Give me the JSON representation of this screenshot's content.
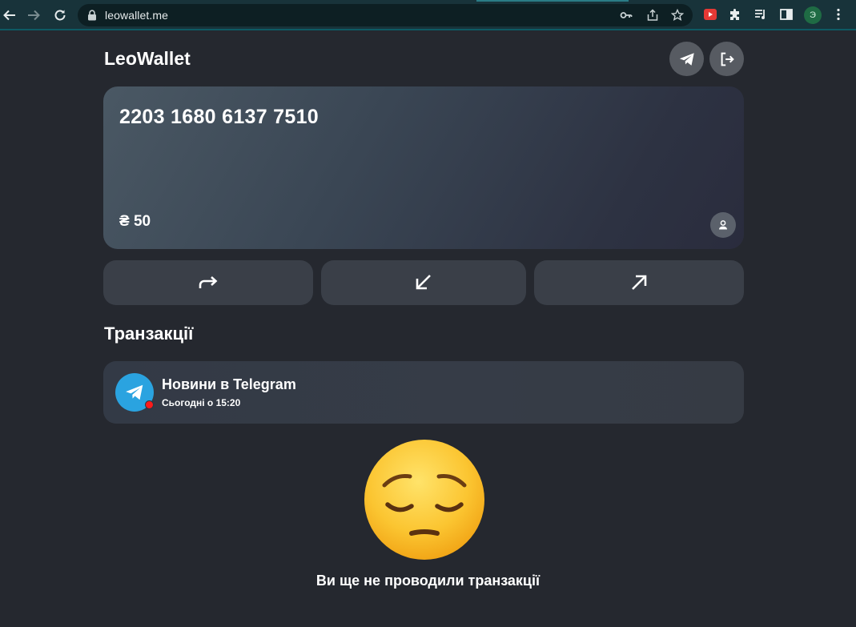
{
  "browser": {
    "url": "leowallet.me",
    "profile_initial": "Э"
  },
  "app": {
    "title": "LeoWallet"
  },
  "card": {
    "number": "2203 1680 6137 7510",
    "balance": "₴ 50"
  },
  "actions": [
    {
      "icon": "forward-arrow-icon"
    },
    {
      "icon": "arrow-down-left-icon"
    },
    {
      "icon": "arrow-up-right-icon"
    }
  ],
  "transactions": {
    "title": "Транзакції",
    "items": [
      {
        "title": "Новини в Telegram",
        "time": "Сьогодні о 15:20",
        "icon": "telegram-icon"
      }
    ],
    "empty_text": "Ви ще не проводили транзакції"
  },
  "colors": {
    "background": "#25282f",
    "card_gradient_start": "#4a5864",
    "card_gradient_end": "#2a2c3d",
    "action_button": "#3a3f48",
    "round_button": "#575b62",
    "telegram_blue": "#2aa3e0",
    "notification_dot": "#ff1a1a"
  }
}
